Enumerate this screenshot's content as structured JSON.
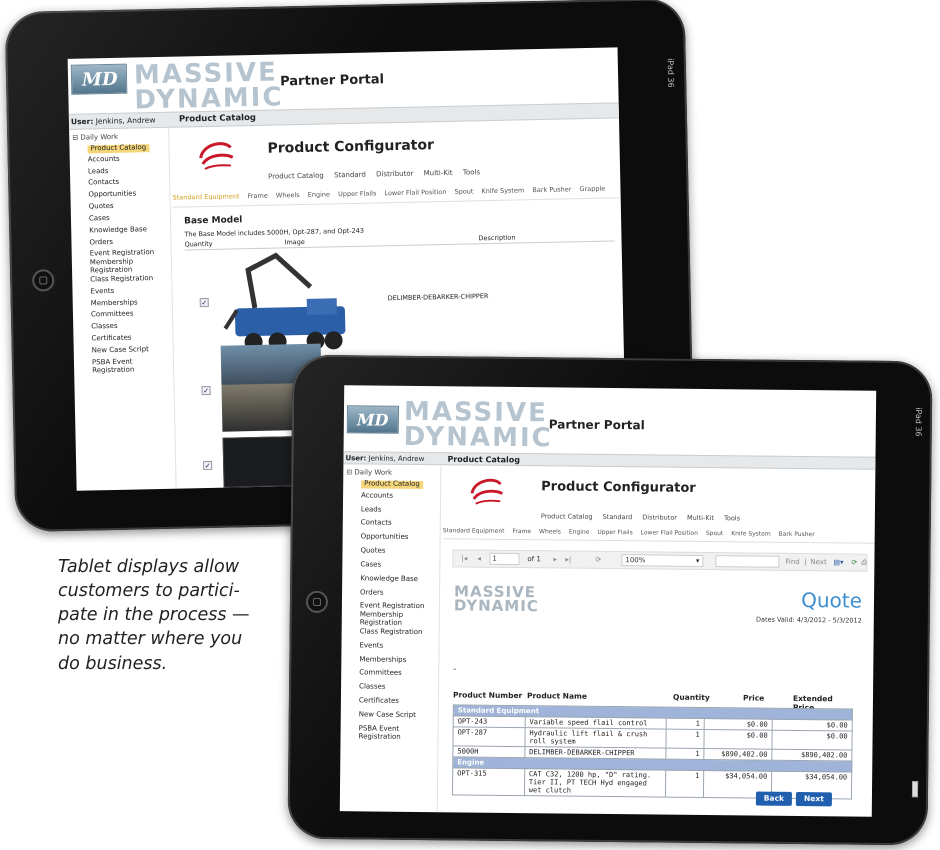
{
  "caption": [
    "Tablet displays allow",
    "customers to partici-",
    "pate in the process —",
    "no matter where you",
    "do business."
  ],
  "device": {
    "label": "iPad",
    "status": "36"
  },
  "portal": {
    "brand_line1": "MASSIVE",
    "brand_line2": "DYNAMIC",
    "logo_mark": "MD",
    "title": "Partner Portal",
    "user_label": "User:",
    "user_name": "Jenkins, Andrew",
    "section": "Product Catalog"
  },
  "sidebar": {
    "root": "Daily Work",
    "items": [
      "Product Catalog",
      "Accounts",
      "Leads",
      "Contacts",
      "Opportunities",
      "Quotes",
      "Cases",
      "Knowledge Base",
      "Orders",
      "Event Registration",
      "Membership Registration",
      "Class Registration",
      "Events",
      "Memberships",
      "Committees",
      "Classes",
      "Certificates",
      "New Case Script",
      "PSBA Event Registration"
    ],
    "active_index": 0
  },
  "configurator": {
    "title": "Product Configurator",
    "tabs": [
      "Product Catalog",
      "Standard",
      "Distributor",
      "Multi-Kit",
      "Tools"
    ],
    "subtabs_back": [
      "Standard Equipment",
      "Frame",
      "Wheels",
      "Engine",
      "Upper Flails",
      "Lower Flail Position",
      "Spout",
      "Knife System",
      "Bark Pusher",
      "Grapple"
    ],
    "subtabs_front": [
      "Standard Equipment",
      "Frame",
      "Wheels",
      "Engine",
      "Upper Flails",
      "Lower Flail Position",
      "Spout",
      "Knife System",
      "Bark Pusher"
    ],
    "base_model_heading": "Base Model",
    "base_model_desc": "The Base Model includes 5000H, Opt-287, and Opt-243",
    "col_quantity": "Quantity",
    "col_image": "Image",
    "col_description": "Description",
    "product_description": "DELIMBER-DEBARKER-CHIPPER"
  },
  "report": {
    "page": "1",
    "of_pages": "of 1",
    "zoom": "100%",
    "find": "Find",
    "next": "Next",
    "separator": "|",
    "brand_line1": "MASSIVE",
    "brand_line2": "DYNAMIC",
    "doc_title": "Quote",
    "dates_valid": "Dates Valid: 4/3/2012 - 5/3/2012",
    "dash": "-",
    "headers": [
      "Product Number",
      "Product Name",
      "Quantity",
      "Price",
      "Extended Price"
    ],
    "sections": [
      {
        "name": "Standard Equipment",
        "rows": [
          {
            "num": "OPT-243",
            "name": "Variable speed flail control",
            "qty": "1",
            "price": "$0.00",
            "ext": "$0.00"
          },
          {
            "num": "OPT-287",
            "name": "Hydraulic lift flail & crush roll system",
            "qty": "1",
            "price": "$0.00",
            "ext": "$0.00"
          },
          {
            "num": "5000H",
            "name": "DELIMBER-DEBARKER-CHIPPER",
            "qty": "1",
            "price": "$890,402.00",
            "ext": "$890,402.00"
          }
        ]
      },
      {
        "name": "Engine",
        "rows": [
          {
            "num": "OPT-315",
            "name": "CAT C32, 1200 hp, \"D\" rating. Tier II, PT TECH Hyd engaged wet clutch",
            "qty": "1",
            "price": "$34,054.00",
            "ext": "$34,054.00"
          }
        ]
      }
    ],
    "back_label": "Back",
    "next_label": "Next"
  },
  "colors": {
    "active_tab": "#d4a020",
    "sidebar_active": "#f6d67a",
    "table_section": "#9fb4d8",
    "button": "#1f5fae"
  }
}
